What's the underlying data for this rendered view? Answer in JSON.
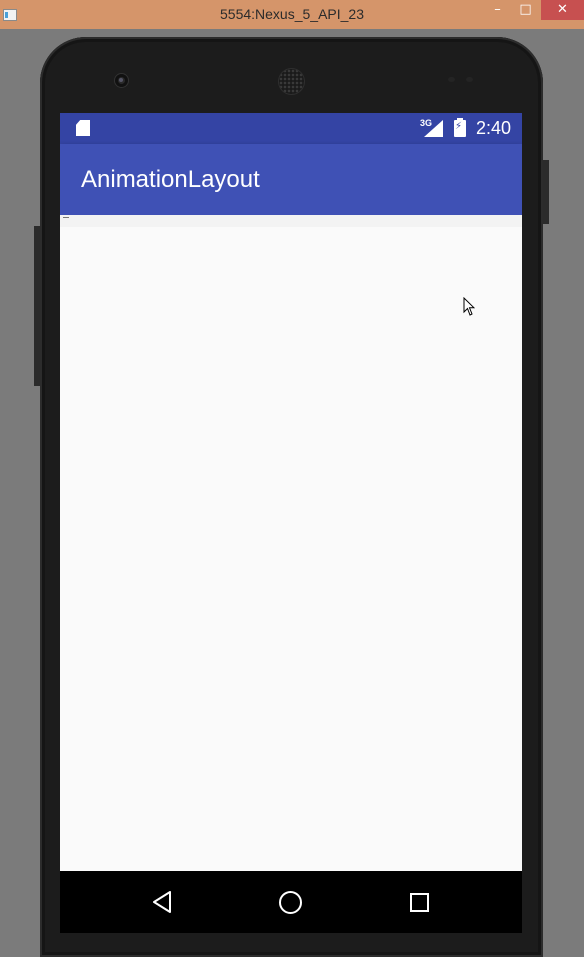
{
  "window": {
    "title": "5554:Nexus_5_API_23",
    "minimize_glyph": "–",
    "maximize_glyph": "□",
    "close_glyph": "✕"
  },
  "status_bar": {
    "network": "3G",
    "time": "2:40",
    "icons": [
      "sd-card-icon",
      "signal-icon",
      "battery-charging-icon"
    ]
  },
  "app_bar": {
    "title": "AnimationLayout"
  },
  "nav_bar": {
    "buttons": [
      "back-icon",
      "home-icon",
      "recent-apps-icon"
    ]
  },
  "colors": {
    "status_bar": "#3444a4",
    "app_bar": "#3f51b5",
    "window_title_bar": "#d5956a",
    "screen_background": "#fafafa"
  }
}
